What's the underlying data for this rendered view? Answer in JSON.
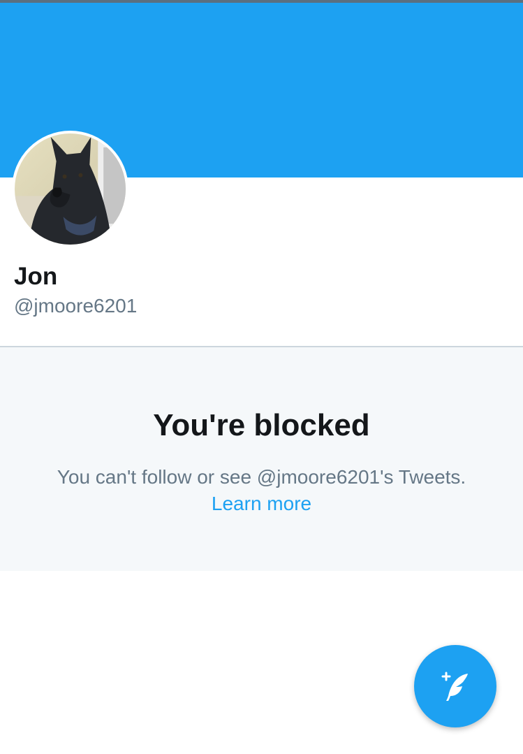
{
  "profile": {
    "name": "Jon",
    "handle": "@jmoore6201"
  },
  "blocked": {
    "title": "You're blocked",
    "message": "You can't follow or see @jmoore6201's Tweets.",
    "learn_more_label": "Learn more"
  },
  "icons": {
    "compose": "compose-tweet-icon",
    "avatar": "avatar-dog-photo"
  },
  "colors": {
    "brand_blue": "#1da1f2",
    "panel_bg": "#f5f8fa",
    "text_primary": "#14171a",
    "text_secondary": "#657786",
    "divider": "#ccd6dd"
  }
}
